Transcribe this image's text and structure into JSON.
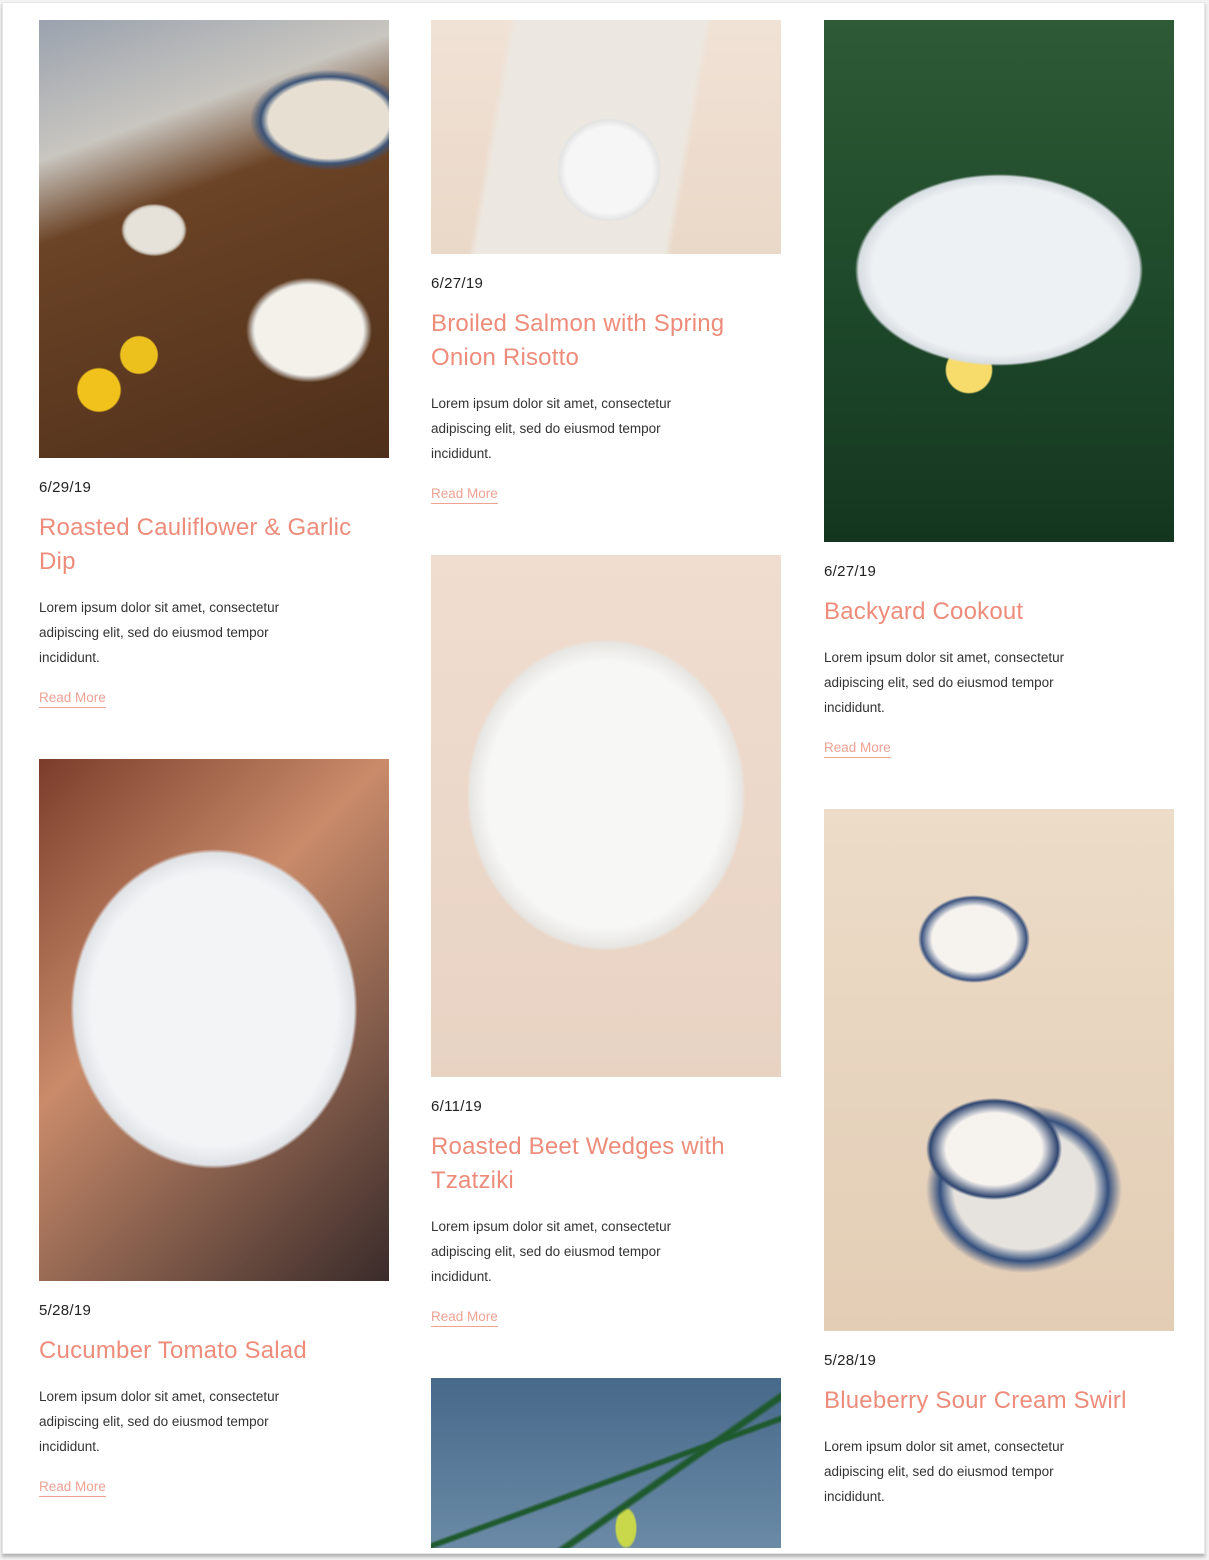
{
  "posts": {
    "col1": [
      {
        "image_alt": "Roasted cauliflower dip with pita on wooden board",
        "date": "6/29/19",
        "title": "Roasted Cauliflower & Garlic Dip",
        "excerpt": "Lorem ipsum dolor sit amet, consectetur adipiscing elit, sed do eiusmod tempor incididunt.",
        "link": "Read More"
      },
      {
        "image_alt": "Cucumber tomato salad in white bowl",
        "date": "5/28/19",
        "title": "Cucumber Tomato Salad",
        "excerpt": "Lorem ipsum dolor sit amet, consectetur adipiscing elit, sed do eiusmod tempor incididunt.",
        "link": "Read More"
      }
    ],
    "col2": [
      {
        "image_alt": "Broiled salmon plate with fork and knife",
        "date": "6/27/19",
        "title": "Broiled Salmon with Spring Onion Risotto",
        "excerpt": "Lorem ipsum dolor sit amet, consectetur adipiscing elit, sed do eiusmod tempor incididunt.",
        "link": "Read More"
      },
      {
        "image_alt": "Roasted beet wedges with tzatziki",
        "date": "6/11/19",
        "title": "Roasted Beet Wedges with Tzatziki",
        "excerpt": "Lorem ipsum dolor sit amet, consectetur adipiscing elit, sed do eiusmod tempor incididunt.",
        "link": "Read More"
      },
      {
        "image_alt": "Drink with chives and lime"
      }
    ],
    "col3": [
      {
        "image_alt": "Grilled fish and vegetables on plate",
        "date": "6/27/19",
        "title": "Backyard Cookout",
        "excerpt": "Lorem ipsum dolor sit amet, consectetur adipiscing elit, sed do eiusmod tempor incididunt.",
        "link": "Read More"
      },
      {
        "image_alt": "Ice cream cones in bowls",
        "date": "5/28/19",
        "title": "Blueberry Sour Cream Swirl",
        "excerpt": "Lorem ipsum dolor sit amet, consectetur adipiscing elit, sed do eiusmod tempor incididunt."
      }
    ]
  }
}
